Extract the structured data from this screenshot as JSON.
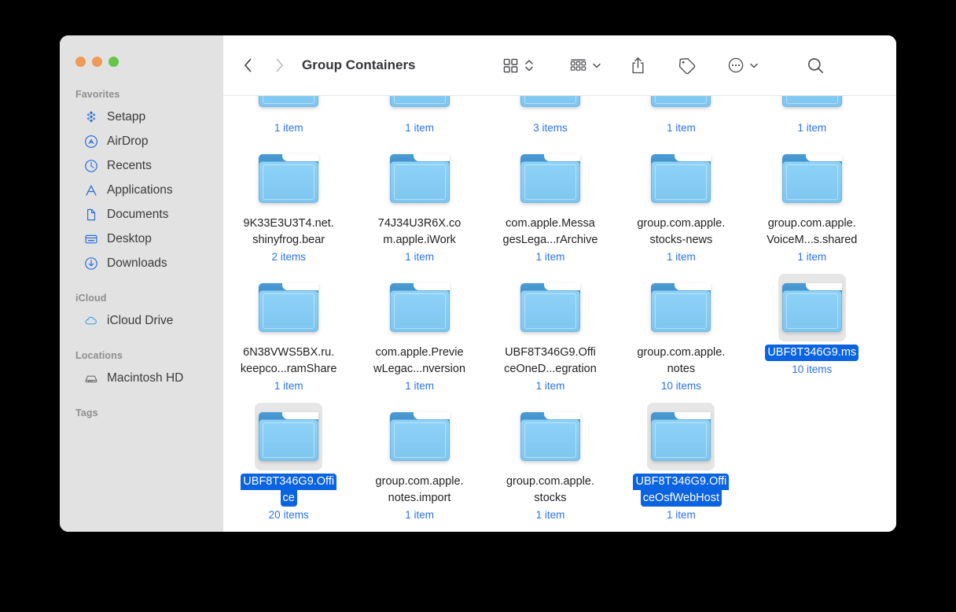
{
  "window": {
    "title": "Group Containers",
    "traffic_lights": [
      {
        "name": "close",
        "color": "#ee9a58"
      },
      {
        "name": "minimize",
        "color": "#ee9a58"
      },
      {
        "name": "maximize",
        "color": "#67c54d"
      }
    ]
  },
  "toolbar": {
    "back_icon": "chevron-left-icon",
    "forward_icon": "chevron-right-icon",
    "view_grid_icon": "grid-view-icon",
    "view_sort_icon": "chevron-updown-icon",
    "group_icon": "group-by-icon",
    "group_caret_icon": "chevron-down-icon",
    "share_icon": "share-icon",
    "tag_icon": "tag-icon",
    "more_icon": "ellipsis-circle-icon",
    "more_caret_icon": "chevron-down-icon",
    "search_icon": "search-icon"
  },
  "sidebar": {
    "sections": [
      {
        "header": "Favorites",
        "items": [
          {
            "label": "Setapp",
            "icon": "setapp-icon"
          },
          {
            "label": "AirDrop",
            "icon": "airdrop-icon"
          },
          {
            "label": "Recents",
            "icon": "clock-icon"
          },
          {
            "label": "Applications",
            "icon": "applications-icon"
          },
          {
            "label": "Documents",
            "icon": "document-icon"
          },
          {
            "label": "Desktop",
            "icon": "desktop-icon"
          },
          {
            "label": "Downloads",
            "icon": "download-icon"
          }
        ]
      },
      {
        "header": "iCloud",
        "items": [
          {
            "label": "iCloud Drive",
            "icon": "cloud-icon"
          }
        ]
      },
      {
        "header": "Locations",
        "items": [
          {
            "label": "Macintosh HD",
            "icon": "harddisk-icon"
          }
        ]
      },
      {
        "header": "Tags",
        "items": []
      }
    ]
  },
  "colors": {
    "accent_blue": "#0a63e0",
    "count_blue": "#2b73e8",
    "sidebar_bg": "#e2e2e2",
    "selection_icon_bg": "#e6e6e6",
    "folder_tab": "#3d8ec9",
    "folder_body": "#7ec6f0"
  },
  "file_grid": {
    "rows": [
      {
        "partial": true,
        "cells": [
          {
            "name_lines": [],
            "count": "1 item",
            "selected": false,
            "icon": "folder-icon"
          },
          {
            "name_lines": [],
            "count": "1 item",
            "selected": false,
            "icon": "folder-icon"
          },
          {
            "name_lines": [],
            "count": "3 items",
            "selected": false,
            "icon": "folder-icon"
          },
          {
            "name_lines": [],
            "count": "1 item",
            "selected": false,
            "icon": "folder-icon"
          },
          {
            "name_lines": [],
            "count": "1 item",
            "selected": false,
            "icon": "folder-icon"
          }
        ]
      },
      {
        "partial": false,
        "cells": [
          {
            "name_lines": [
              "9K33E3U3T4.net.",
              "shinyfrog.bear"
            ],
            "count": "2 items",
            "selected": false,
            "icon": "folder-icon"
          },
          {
            "name_lines": [
              "74J34U3R6X.co",
              "m.apple.iWork"
            ],
            "count": "1 item",
            "selected": false,
            "icon": "folder-icon"
          },
          {
            "name_lines": [
              "com.apple.Messa",
              "gesLega...rArchive"
            ],
            "count": "1 item",
            "selected": false,
            "icon": "folder-icon"
          },
          {
            "name_lines": [
              "group.com.apple.",
              "stocks-news"
            ],
            "count": "1 item",
            "selected": false,
            "icon": "folder-icon"
          },
          {
            "name_lines": [
              "group.com.apple.",
              "VoiceM...s.shared"
            ],
            "count": "1 item",
            "selected": false,
            "icon": "folder-icon"
          }
        ]
      },
      {
        "partial": false,
        "cells": [
          {
            "name_lines": [
              "6N38VWS5BX.ru.",
              "keepco...ramShare"
            ],
            "count": "1 item",
            "selected": false,
            "icon": "folder-icon"
          },
          {
            "name_lines": [
              "com.apple.Previe",
              "wLegac...nversion"
            ],
            "count": "1 item",
            "selected": false,
            "icon": "folder-icon"
          },
          {
            "name_lines": [
              "UBF8T346G9.Offi",
              "ceOneD...egration"
            ],
            "count": "1 item",
            "selected": false,
            "icon": "folder-icon"
          },
          {
            "name_lines": [
              "group.com.apple.",
              "notes"
            ],
            "count": "10 items",
            "selected": false,
            "icon": "folder-icon"
          },
          {
            "name_lines": [
              "UBF8T346G9.ms"
            ],
            "count": "10 items",
            "selected": true,
            "icon": "folder-icon"
          }
        ]
      },
      {
        "partial": false,
        "cells": [
          {
            "name_lines": [
              "UBF8T346G9.Offi",
              "ce"
            ],
            "count": "20 items",
            "selected": true,
            "icon": "folder-icon"
          },
          {
            "name_lines": [
              "group.com.apple.",
              "notes.import"
            ],
            "count": "1 item",
            "selected": false,
            "icon": "folder-icon"
          },
          {
            "name_lines": [
              "group.com.apple.",
              "stocks"
            ],
            "count": "1 item",
            "selected": false,
            "icon": "folder-icon"
          },
          {
            "name_lines": [
              "UBF8T346G9.Offi",
              "ceOsfWebHost"
            ],
            "count": "1 item",
            "selected": true,
            "icon": "folder-icon"
          },
          {
            "name_lines": [],
            "count": "",
            "selected": false,
            "icon": "none"
          }
        ]
      }
    ]
  }
}
